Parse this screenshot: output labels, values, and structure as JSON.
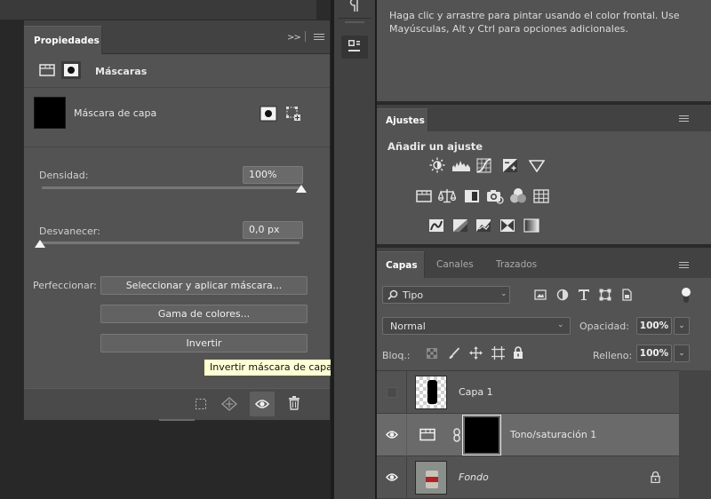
{
  "properties": {
    "tab_label": "Propiedades",
    "collapse_label": ">>",
    "mode_title": "Máscaras",
    "mask_label": "Máscara de capa",
    "density_label": "Densidad:",
    "density_value": "100%",
    "density_fraction": 1.0,
    "feather_label": "Desvanecer:",
    "feather_value": "0,0 px",
    "feather_fraction": 0.0,
    "refine_label": "Perfeccionar:",
    "select_mask_button": "Seleccionar y aplicar máscara...",
    "color_range_button": "Gama de colores...",
    "invert_button": "Invertir",
    "tooltip": "Invertir máscara de capa"
  },
  "info": {
    "text": "Haga clic y arrastre para pintar usando el color frontal. Use Mayúsculas, Alt y Ctrl para opciones adicionales."
  },
  "adjustments": {
    "tab_label": "Ajustes",
    "heading": "Añadir un ajuste",
    "rows": [
      [
        "brightness-contrast-icon",
        "levels-icon",
        "curves-icon",
        "exposure-icon",
        "vibrance-icon"
      ],
      [
        "hue-saturation-icon",
        "color-balance-icon",
        "black-white-icon",
        "photo-filter-icon",
        "channel-mixer-icon",
        "color-lookup-icon"
      ],
      [
        "invert-adjust-icon",
        "posterize-icon",
        "threshold-icon",
        "selective-color-icon",
        "gradient-map-icon"
      ]
    ]
  },
  "layers": {
    "tabs": [
      "Capas",
      "Canales",
      "Trazados"
    ],
    "filter_label": "Tipo",
    "blend_mode": "Normal",
    "opacity_label": "Opacidad:",
    "opacity_value": "100%",
    "lock_label": "Bloq.:",
    "fill_label": "Relleno:",
    "fill_value": "100%",
    "items": [
      {
        "name": "Capa 1",
        "visible": false
      },
      {
        "name": "Tono/saturación 1",
        "visible": true
      },
      {
        "name": "Fondo",
        "visible": true
      }
    ]
  },
  "colors": {
    "panel": "#535353",
    "tabbar": "#424242",
    "tooltip_bg": "#ffffd6"
  }
}
